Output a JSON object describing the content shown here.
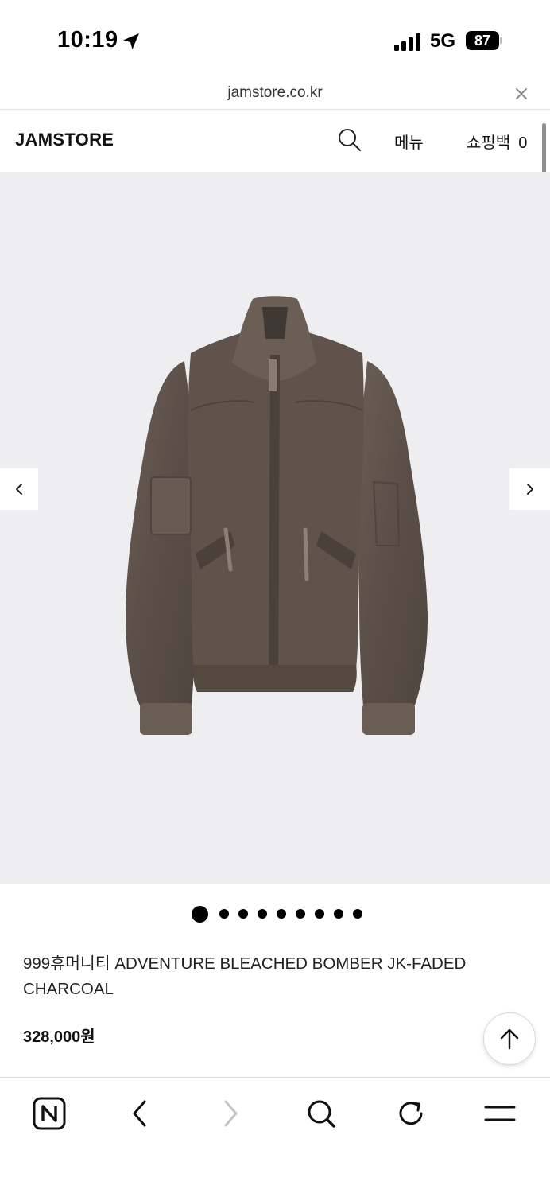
{
  "status_bar": {
    "time": "10:19",
    "network": "5G",
    "battery": "87",
    "icons": [
      "location-arrow-icon",
      "signal-bars-icon",
      "battery-icon"
    ]
  },
  "url_bar": {
    "url": "jamstore.co.kr",
    "close_icon": "close-icon"
  },
  "header": {
    "logo": "JAMSTORE",
    "search_icon": "search-icon",
    "menu_label": "메뉴",
    "bag_label": "쇼핑백",
    "bag_count": "0"
  },
  "gallery": {
    "prev_icon": "chevron-left-icon",
    "next_icon": "chevron-right-icon",
    "total_images": 9,
    "active_index": 0
  },
  "product": {
    "name": "999휴머니티 ADVENTURE BLEACHED BOMBER JK-FADED CHARCOAL",
    "price": "328,000원"
  },
  "scroll_top_icon": "arrow-up-icon",
  "toolbar": {
    "items": [
      "naver-home-icon",
      "back-icon",
      "forward-icon",
      "search-icon",
      "reload-icon",
      "menu-icon"
    ]
  },
  "colors": {
    "gallery_bg": "#eeeef0",
    "jacket": "#5e524b",
    "text": "#111111"
  }
}
